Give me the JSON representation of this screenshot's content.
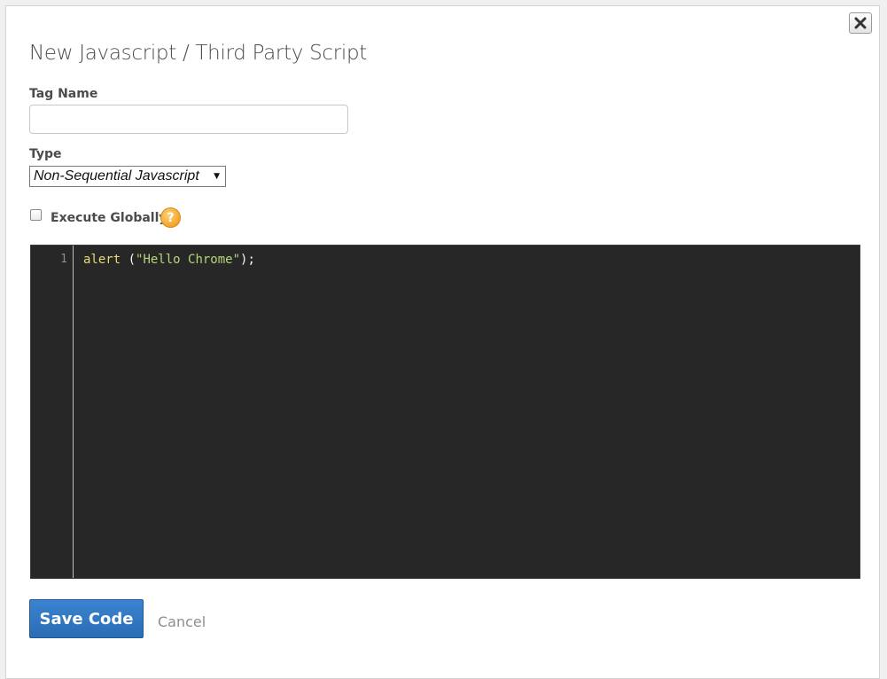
{
  "dialog": {
    "title": "New Javascript / Third Party Script",
    "close_icon": "close-x-icon"
  },
  "form": {
    "tag_name_label": "Tag Name",
    "tag_name_value": "",
    "tag_name_placeholder": "",
    "type_label": "Type",
    "type_selected": "Non-Sequential Javascript",
    "execute_globally_label": "Execute Globally",
    "execute_globally_checked": false,
    "help_icon_glyph": "?"
  },
  "editor": {
    "line_numbers": [
      "1"
    ],
    "tokens": {
      "fn": "alert",
      "open": " (",
      "str": "\"Hello Chrome\"",
      "close": ");"
    }
  },
  "actions": {
    "save_label": "Save Code",
    "cancel_label": "Cancel"
  },
  "colors": {
    "primary_button": "#2a6db4",
    "editor_background": "#272727",
    "help_icon": "#f3a52a",
    "code_function": "#e6db74",
    "code_string": "#b5d67a"
  }
}
